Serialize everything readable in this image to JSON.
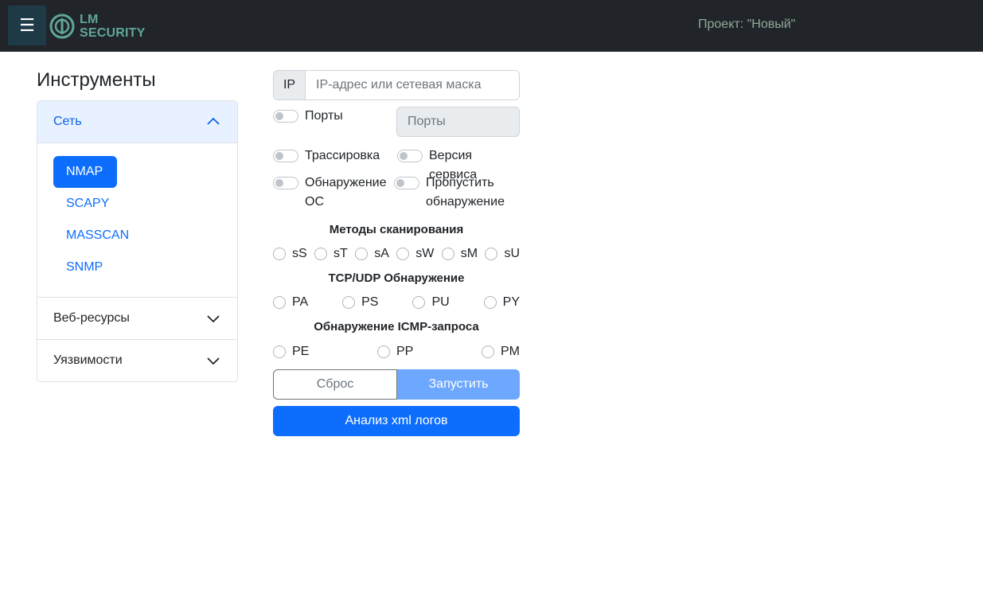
{
  "navbar": {
    "menu_icon": "☰",
    "logo_line1": "LM",
    "logo_line2": "SECURITY",
    "project": "Проект: \"Новый\""
  },
  "sidebar": {
    "title": "Инструменты",
    "sections": [
      {
        "label": "Сеть",
        "expanded": true
      },
      {
        "label": "Веб-ресурсы",
        "expanded": false
      },
      {
        "label": "Уязвимости",
        "expanded": false
      }
    ],
    "tools": [
      "NMAP",
      "SCAPY",
      "MASSCAN",
      "SNMP"
    ],
    "active_tool": "NMAP"
  },
  "form": {
    "ip_prefix": "IP",
    "ip_placeholder": "IP-адрес или сетевая маска",
    "ports_label": "Порты",
    "ports_placeholder": "Порты",
    "traceroute_label": "Трассировка",
    "service_version_label": "Версия сервиса",
    "os_detection_line1": "Обнаружение",
    "os_detection_line2": "ОС",
    "skip_discovery_line1": "Пропустить",
    "skip_discovery_line2": "обнаружение",
    "scan_methods_title": "Методы сканирования",
    "scan_methods": [
      "sS",
      "sT",
      "sA",
      "sW",
      "sM",
      "sU"
    ],
    "tcp_udp_title": "TCP/UDP Обнаружение",
    "tcp_udp": [
      "PA",
      "PS",
      "PU",
      "PY"
    ],
    "icmp_title": "Обнаружение ICMP-запроса",
    "icmp": [
      "PE",
      "PP",
      "PM"
    ],
    "reset_label": "Сброс",
    "run_label": "Запустить",
    "xml_label": "Анализ xml логов"
  },
  "colors": {
    "navbar_bg": "#212529",
    "accent": "#0d6efd",
    "accent_light": "#6ea8fe",
    "logo": "#5fa79b"
  }
}
